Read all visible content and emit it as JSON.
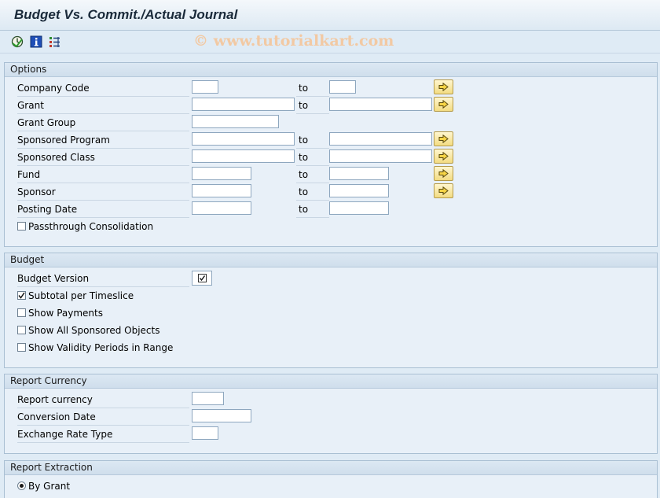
{
  "window": {
    "title": "Budget Vs. Commit./Actual Journal"
  },
  "watermark": "© www.tutorialkart.com",
  "toolbar": {
    "icons": [
      "execute-icon",
      "information-icon",
      "selection-options-icon"
    ]
  },
  "options": {
    "header": "Options",
    "to_label": "to",
    "company_code": {
      "label": "Company Code",
      "from": "",
      "to": ""
    },
    "grant": {
      "label": "Grant",
      "from": "",
      "to": ""
    },
    "grant_group": {
      "label": "Grant Group",
      "value": ""
    },
    "sponsored_program": {
      "label": "Sponsored Program",
      "from": "",
      "to": ""
    },
    "sponsored_class": {
      "label": "Sponsored Class",
      "from": "",
      "to": ""
    },
    "fund": {
      "label": "Fund",
      "from": "",
      "to": ""
    },
    "sponsor": {
      "label": "Sponsor",
      "from": "",
      "to": ""
    },
    "posting_date": {
      "label": "Posting Date",
      "from": "",
      "to": ""
    },
    "passthrough": {
      "label": "Passthrough Consolidation",
      "checked": false
    }
  },
  "budget": {
    "header": "Budget",
    "budget_version": {
      "label": "Budget Version",
      "checked": true
    },
    "subtotal_timeslice": {
      "label": "Subtotal per Timeslice",
      "checked": true
    },
    "show_payments": {
      "label": "Show Payments",
      "checked": false
    },
    "show_all_sponsored": {
      "label": "Show All Sponsored Objects",
      "checked": false
    },
    "show_validity": {
      "label": "Show Validity Periods in Range",
      "checked": false
    }
  },
  "report_currency": {
    "header": "Report Currency",
    "report_currency": {
      "label": "Report currency",
      "value": ""
    },
    "conversion_date": {
      "label": "Conversion Date",
      "value": ""
    },
    "exchange_rate_type": {
      "label": "Exchange Rate Type",
      "value": ""
    }
  },
  "report_extraction": {
    "header": "Report Extraction",
    "by_grant": {
      "label": "By Grant",
      "selected": true
    }
  },
  "colors": {
    "background": "#dfebf5",
    "group_background": "#e8f0f8",
    "button_yellow": "#f3dc82",
    "border": "#a9bfd3"
  }
}
